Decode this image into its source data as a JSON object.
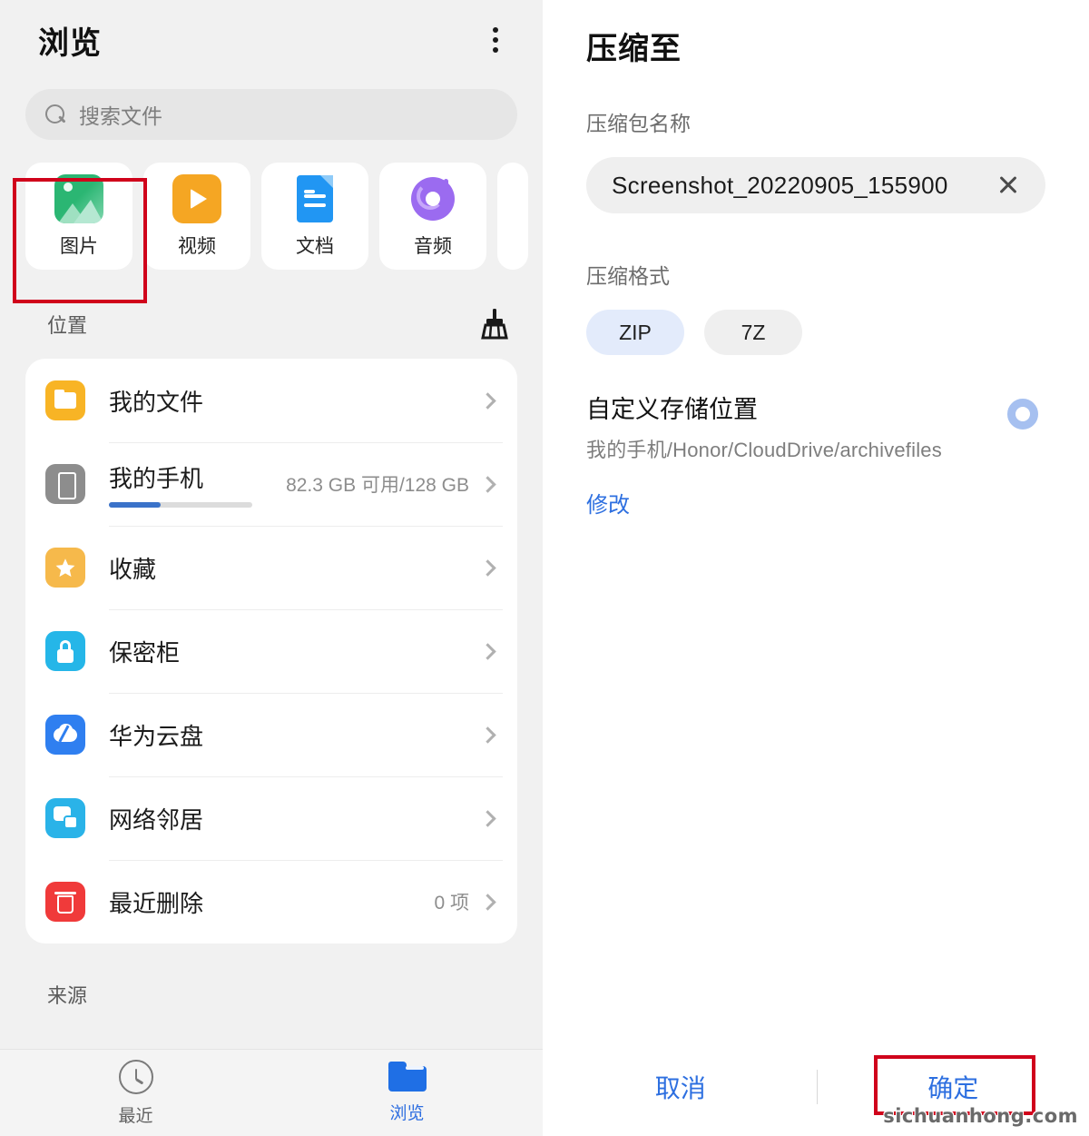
{
  "left_panel": {
    "title": "浏览",
    "menu_icon": "kebab-menu-icon",
    "search": {
      "placeholder": "搜索文件",
      "icon": "search-icon"
    },
    "categories": [
      {
        "label": "图片",
        "icon": "picture-icon",
        "highlighted": true
      },
      {
        "label": "视频",
        "icon": "video-icon",
        "highlighted": false
      },
      {
        "label": "文档",
        "icon": "document-icon",
        "highlighted": false
      },
      {
        "label": "音频",
        "icon": "audio-icon",
        "highlighted": false
      }
    ],
    "location_section": {
      "label": "位置",
      "clean_icon": "broom-icon"
    },
    "locations": [
      {
        "label": "我的文件",
        "icon": "folder-icon",
        "meta": ""
      },
      {
        "label": "我的手机",
        "icon": "phone-icon",
        "meta": "82.3 GB 可用/128 GB",
        "progress_percent": 36
      },
      {
        "label": "收藏",
        "icon": "star-icon",
        "meta": ""
      },
      {
        "label": "保密柜",
        "icon": "lock-icon",
        "meta": ""
      },
      {
        "label": "华为云盘",
        "icon": "cloud-icon",
        "meta": ""
      },
      {
        "label": "网络邻居",
        "icon": "network-icon",
        "meta": ""
      },
      {
        "label": "最近删除",
        "icon": "trash-icon",
        "meta": "0 项"
      }
    ],
    "source_label": "来源",
    "bottom_nav": [
      {
        "label": "最近",
        "icon": "clock-icon",
        "active": false
      },
      {
        "label": "浏览",
        "icon": "folder-blue-icon",
        "active": true
      }
    ]
  },
  "right_panel": {
    "title": "压缩至",
    "archive_name_label": "压缩包名称",
    "archive_name_value": "Screenshot_20220905_155900",
    "clear_icon": "close-icon",
    "format_label": "压缩格式",
    "formats": [
      {
        "label": "ZIP",
        "selected": true
      },
      {
        "label": "7Z",
        "selected": false
      }
    ],
    "custom_location": {
      "title": "自定义存储位置",
      "path": "我的手机/Honor/CloudDrive/archivefiles",
      "radio_icon": "radio-ring-icon",
      "edit_label": "修改"
    },
    "actions": {
      "cancel_label": "取消",
      "confirm_label": "确定",
      "confirm_highlighted": true
    }
  },
  "watermark": "sichuanhong.com",
  "colors": {
    "accent_blue": "#2d6fe0",
    "highlight_red": "#d0021b",
    "chip_selected_bg": "#e3ebfb",
    "panel_bg": "#f1f1f1",
    "card_bg": "#ffffff"
  }
}
